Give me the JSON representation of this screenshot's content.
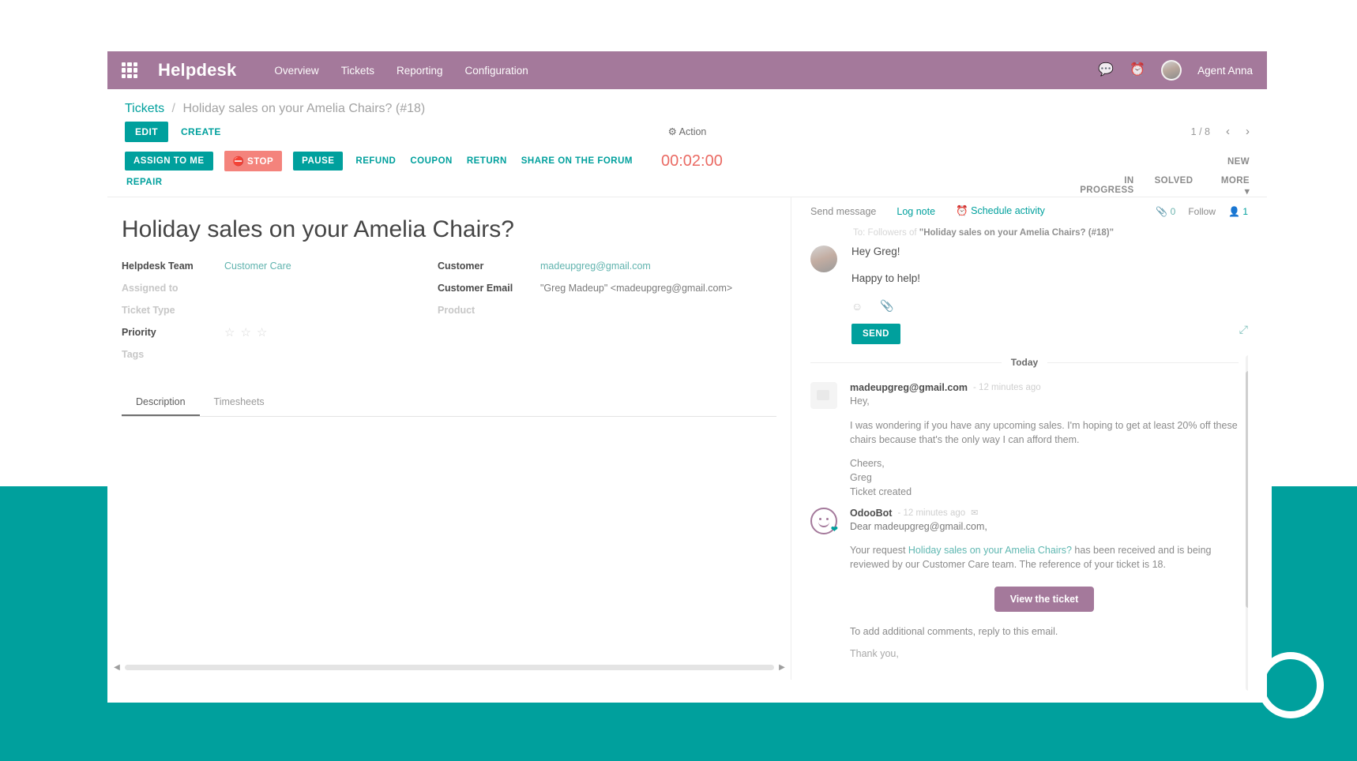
{
  "topbar": {
    "brand": "Helpdesk",
    "apps_icon": "grid-apps-icon",
    "menu": [
      "Overview",
      "Tickets",
      "Reporting",
      "Configuration"
    ],
    "messages_icon": "chat-bubbles-icon",
    "activities_icon": "clock-icon",
    "user_name": "Agent Anna",
    "bar_color": "#a4799b"
  },
  "breadcrumb": {
    "root": "Tickets",
    "separator": "/",
    "current": "Holiday sales on your Amelia Chairs? (#18)"
  },
  "controls": {
    "edit": "EDIT",
    "create": "CREATE",
    "action": "Action",
    "action_icon": "gear-icon",
    "pager_count": "1 / 8",
    "prev_icon": "chevron-left-icon",
    "next_icon": "chevron-right-icon"
  },
  "actions": {
    "row1": [
      {
        "label": "ASSIGN TO ME",
        "style": "teal"
      },
      {
        "label": "STOP",
        "style": "red",
        "icon": "stop-circle-icon"
      },
      {
        "label": "PAUSE",
        "style": "teal"
      },
      {
        "label": "REFUND",
        "style": "link"
      },
      {
        "label": "COUPON",
        "style": "link"
      },
      {
        "label": "RETURN",
        "style": "link"
      },
      {
        "label": "SHARE ON THE FORUM",
        "style": "link"
      }
    ],
    "row2": [
      {
        "label": "REPAIR",
        "style": "link"
      }
    ],
    "timer": "00:02:00",
    "timer_color": "#ea6a63"
  },
  "statusbar": {
    "current": "NEW",
    "stages": [
      "IN PROGRESS",
      "SOLVED"
    ],
    "more": "MORE",
    "more_caret": "caret-down-icon"
  },
  "form": {
    "title": "Holiday sales on your Amelia Chairs?",
    "left_fields": [
      {
        "label": "Helpdesk Team",
        "value": "Customer Care",
        "type": "link",
        "muted": false
      },
      {
        "label": "Assigned to",
        "value": "",
        "type": "text",
        "muted": true
      },
      {
        "label": "Ticket Type",
        "value": "",
        "type": "text",
        "muted": true
      },
      {
        "label": "Priority",
        "value": "",
        "type": "stars",
        "muted": false
      },
      {
        "label": "Tags",
        "value": "",
        "type": "text",
        "muted": true
      }
    ],
    "priority_stars": 3,
    "priority_filled": 0,
    "right_fields": [
      {
        "label": "Customer",
        "value": "madeupgreg@gmail.com",
        "type": "link",
        "muted": false
      },
      {
        "label": "Customer Email",
        "value": "\"Greg Madeup\" <madeupgreg@gmail.com>",
        "type": "text",
        "muted": false
      },
      {
        "label": "Product",
        "value": "",
        "type": "text",
        "muted": true
      }
    ],
    "tabs": [
      {
        "label": "Description",
        "active": true
      },
      {
        "label": "Timesheets",
        "active": false
      }
    ]
  },
  "chatter": {
    "actions": [
      {
        "label": "Send message",
        "tone": "grey"
      },
      {
        "label": "Log note",
        "tone": "teal"
      },
      {
        "label": "Schedule activity",
        "tone": "teal",
        "icon": "clock-icon"
      }
    ],
    "attachment_icon": "paperclip-icon",
    "attachment_count": "0",
    "follow": "Follow",
    "followers_icon": "user-icon",
    "followers_count": "1",
    "composer": {
      "to_prefix": "To:",
      "to_audience": "Followers of",
      "to_target": "\"Holiday sales on your Amelia Chairs? (#18)\"",
      "draft_lines": [
        "Hey Greg!",
        "Happy to help!"
      ],
      "emoji_icon": "smiley-icon",
      "attach_icon": "paperclip-icon",
      "expand_icon": "expand-arrows-icon",
      "send_label": "SEND"
    },
    "day_divider": "Today",
    "posts": [
      {
        "avatar": "email-placeholder-icon",
        "author": "madeupgreg@gmail.com",
        "time": "- 12 minutes ago",
        "paragraphs": [
          "Hey,",
          "I was wondering if you have any upcoming sales. I'm hoping to get at least 20% off these chairs because that's the only way I can afford them.",
          "Cheers,\nGreg\nTicket created"
        ]
      },
      {
        "avatar": "odoobot-smiley-icon",
        "author": "OdooBot",
        "time": "- 12 minutes ago",
        "envelope_icon": "envelope-icon",
        "greeting": "Dear madeupgreg@gmail.com,",
        "body_prefix": "Your request ",
        "body_link": "Holiday sales on your Amelia Chairs?",
        "body_suffix": " has been received and is being reviewed by our Customer Care team. The reference of your ticket is 18.",
        "cta_label": "View the ticket",
        "cta_color": "#a4799b",
        "note": "To add additional comments, reply to this email.",
        "thanks": "Thank you,"
      }
    ]
  },
  "theme": {
    "accent_teal": "#00A09D",
    "accent_purple": "#a4799b",
    "danger": "#f4837c"
  }
}
